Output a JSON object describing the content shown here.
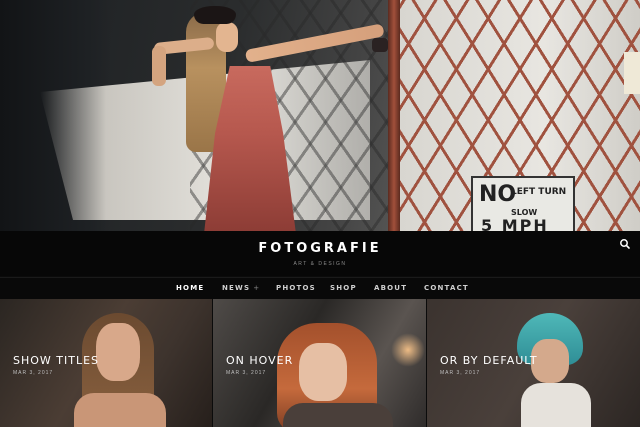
{
  "header": {
    "logo": "FOTOGRAFIE",
    "tagline": "ART & DESIGN",
    "search_icon": "search-icon"
  },
  "hero": {
    "sign_text_large": "NO",
    "sign_text_turn": "LEFT TURN",
    "sign_text_slow": "SLOW",
    "sign_text_mph": "5 MPH"
  },
  "nav": {
    "items": [
      {
        "label": "HOME",
        "active": true
      },
      {
        "label": "NEWS",
        "has_submenu": true,
        "submenu_glyph": "+"
      },
      {
        "label": "PHOTOS"
      },
      {
        "label": "SHOP"
      },
      {
        "label": "ABOUT"
      },
      {
        "label": "CONTACT"
      }
    ]
  },
  "gallery": {
    "tiles": [
      {
        "title": "SHOW TITLES",
        "date": "MAR 3, 2017"
      },
      {
        "title": "ON HOVER",
        "date": "MAR 3, 2017"
      },
      {
        "title": "OR BY DEFAULT",
        "date": "MAR 3, 2017"
      }
    ]
  },
  "colors": {
    "background": "#0b0b0b",
    "nav_text": "#cfcfcf",
    "tagline": "#8b8b8b",
    "fence": "#a0523f"
  }
}
